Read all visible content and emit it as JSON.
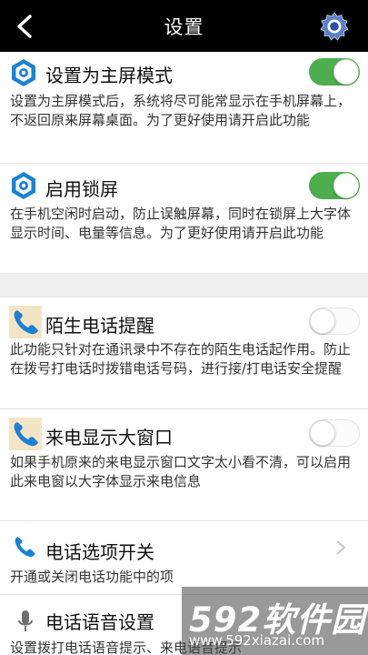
{
  "header": {
    "title": "设置"
  },
  "items": [
    {
      "title": "设置为主屏模式",
      "desc": "设置为主屏模式后，系统将尽可能常显示在手机屏幕上，不返回原来屏幕桌面。为了更好使用请开启此功能",
      "toggle": "on",
      "icon": "hexagon-settings-icon"
    },
    {
      "title": "启用锁屏",
      "desc": "在手机空闲时启动，防止误触屏幕，同时在锁屏上大字体显示时间、电量等信息。为了更好使用请开启此功能",
      "toggle": "on",
      "icon": "hexagon-settings-icon"
    },
    {
      "title": "陌生电话提醒",
      "desc": "此功能只针对在通讯录中不存在的陌生电话起作用。防止在拨号打电话时拨错电话号码，进行接/打电话安全提醒",
      "toggle": "off",
      "icon": "phone-icon"
    },
    {
      "title": "来电显示大窗口",
      "desc": "如果手机原来的来电显示窗口文字太小看不清，可以启用此来电窗以大字体显示来电信息",
      "toggle": "off",
      "icon": "phone-icon"
    },
    {
      "title": "电话选项开关",
      "desc": "开通或关闭电话功能中的项",
      "icon": "phone-icon"
    },
    {
      "title": "电话语音设置",
      "desc": "设置拨打电话语音提示、来电语音提示",
      "icon": "microphone-icon"
    }
  ],
  "watermark": {
    "logo": "592软件园",
    "url": "www.592xiazai.com"
  },
  "colors": {
    "header_bg": "#000000",
    "toggle_on": "#4cae4c",
    "icon_blue": "#1a82d6",
    "gap_bg": "#efefef"
  }
}
